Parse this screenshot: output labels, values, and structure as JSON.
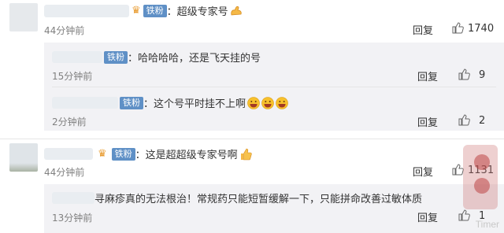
{
  "comments": [
    {
      "badge": "铁粉",
      "text": "：超级专家号",
      "time": "44分钟前",
      "reply_label": "回复",
      "likes": "1740",
      "replies": [
        {
          "badge": "铁粉",
          "text": "：哈哈哈哈，还是飞天挂的号",
          "time": "15分钟前",
          "reply_label": "回复",
          "likes": "9"
        },
        {
          "badge": "铁粉",
          "text": "：这个号平时挂不上啊",
          "time": "2分钟前",
          "reply_label": "回复",
          "likes": "2"
        }
      ]
    },
    {
      "badge": "铁粉",
      "text": "：这是超超级专家号啊",
      "time": "44分钟前",
      "reply_label": "回复",
      "likes": "1131",
      "replies": [
        {
          "text": "寻麻疹真的无法根治！常规药只能短暂缓解一下，只能拼命改善过敏体质",
          "time": "13分钟前",
          "reply_label": "回复",
          "likes": "1"
        }
      ]
    }
  ],
  "watermark": "Timer",
  "icons": {
    "like": "thumbs-up-icon",
    "grin": "grinning-face-icon",
    "muscle": "flexed-biceps-icon",
    "vip": "crown-icon"
  },
  "colors": {
    "badge": "#5f90c6",
    "reply_bg": "#f2f2f5",
    "meta": "#808080"
  }
}
